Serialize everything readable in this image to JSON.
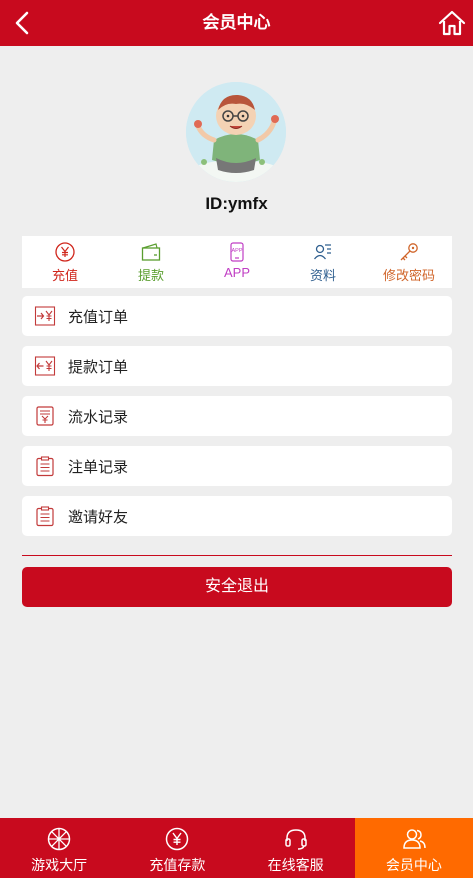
{
  "header": {
    "title": "会员中心",
    "back_icon": "chevron-left-icon",
    "home_icon": "home-icon"
  },
  "profile": {
    "user_id": "ID:ymfx",
    "avatar": "cartoon-avatar"
  },
  "quick_actions": [
    {
      "label": "充值",
      "icon": "yen-circle-icon",
      "color": "#d0261c"
    },
    {
      "label": "提款",
      "icon": "wallet-icon",
      "color": "#5a9e2f"
    },
    {
      "label": "APP",
      "icon": "app-phone-icon",
      "color": "#c03ec4"
    },
    {
      "label": "资料",
      "icon": "id-card-icon",
      "color": "#2f5f8f"
    },
    {
      "label": "修改密码",
      "icon": "key-icon",
      "color": "#d0652a"
    }
  ],
  "menu": [
    {
      "label": "充值订单",
      "icon": "deposit-order-icon"
    },
    {
      "label": "提款订单",
      "icon": "withdraw-order-icon"
    },
    {
      "label": "流水记录",
      "icon": "ledger-icon"
    },
    {
      "label": "注单记录",
      "icon": "clipboard-icon"
    },
    {
      "label": "邀请好友",
      "icon": "clipboard-icon"
    }
  ],
  "logout_label": "安全退出",
  "tabbar": [
    {
      "label": "游戏大厅",
      "icon": "wheel-icon",
      "active": false
    },
    {
      "label": "充值存款",
      "icon": "yen-circle-icon",
      "active": false
    },
    {
      "label": "在线客服",
      "icon": "headset-icon",
      "active": false
    },
    {
      "label": "会员中心",
      "icon": "users-icon",
      "active": true
    }
  ],
  "colors": {
    "brand_red": "#c80a1e",
    "active_tab": "#ff6a00",
    "background": "#eeeeee"
  }
}
